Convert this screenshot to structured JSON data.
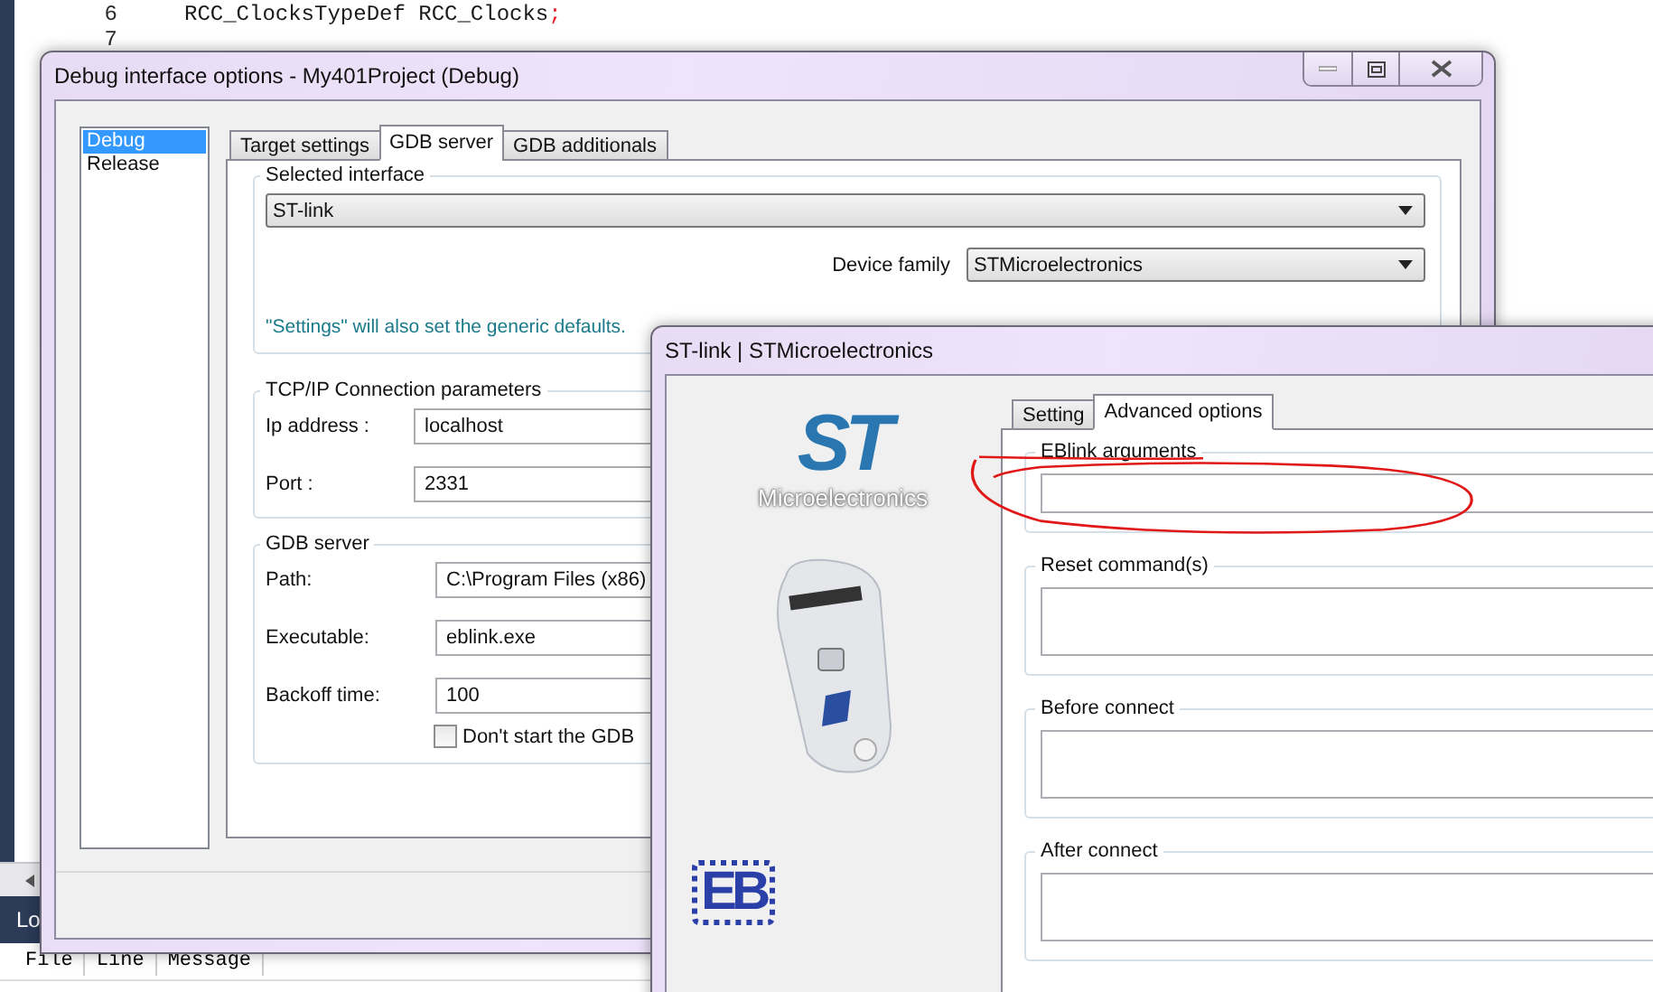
{
  "editor": {
    "lines": [
      {
        "number": "6",
        "tokens": [
          {
            "text": "RCC_ClocksTypeDef RCC_Clocks",
            "kind": "code"
          },
          {
            "text": ";",
            "kind": "punct"
          }
        ]
      },
      {
        "number": "7"
      }
    ]
  },
  "log_panel": {
    "tab": "Lo",
    "columns": [
      "File",
      "Line",
      "Message"
    ]
  },
  "debug_dialog": {
    "title": "Debug interface options - My401Project (Debug)",
    "configurations": [
      {
        "label": "Debug",
        "selected": true
      },
      {
        "label": "Release",
        "selected": false
      }
    ],
    "tabs": [
      {
        "label": "Target settings",
        "selected": false
      },
      {
        "label": "GDB server",
        "selected": true
      },
      {
        "label": "GDB additionals",
        "selected": false
      }
    ],
    "selected_interface": {
      "label": "Selected interface",
      "value": "ST-link"
    },
    "device_family": {
      "label": "Device family",
      "value": "STMicroelectronics"
    },
    "settings_note": "\"Settings\" will also set the generic defaults.",
    "tcp_ip": {
      "label": "TCP/IP Connection parameters",
      "fields": [
        {
          "label": "Ip address :",
          "value": "localhost"
        },
        {
          "label": "Port :",
          "value": "2331"
        }
      ]
    },
    "gdb_server": {
      "label": "GDB server",
      "fields": [
        {
          "label": "Path:",
          "value": "C:\\Program Files (x86)"
        },
        {
          "label": "Executable:",
          "value": "eblink.exe"
        },
        {
          "label": "Backoff time:",
          "value": "100"
        }
      ],
      "dont_start": {
        "label": "Don't start the GDB",
        "checked": false
      }
    }
  },
  "stlink_dialog": {
    "title": "ST-link | STMicroelectronics",
    "brand_mark": "ST",
    "logo_caption": "Microelectronics",
    "footer_logo": "EB",
    "tabs": [
      {
        "label": "Setting",
        "selected": false
      },
      {
        "label": "Advanced options",
        "selected": true
      }
    ],
    "groups": [
      {
        "label": "EBlink arguments",
        "kind": "line"
      },
      {
        "label": "Reset command(s)",
        "kind": "multiline"
      },
      {
        "label": "Before connect",
        "kind": "multiline"
      },
      {
        "label": "After connect",
        "kind": "multiline"
      }
    ]
  }
}
